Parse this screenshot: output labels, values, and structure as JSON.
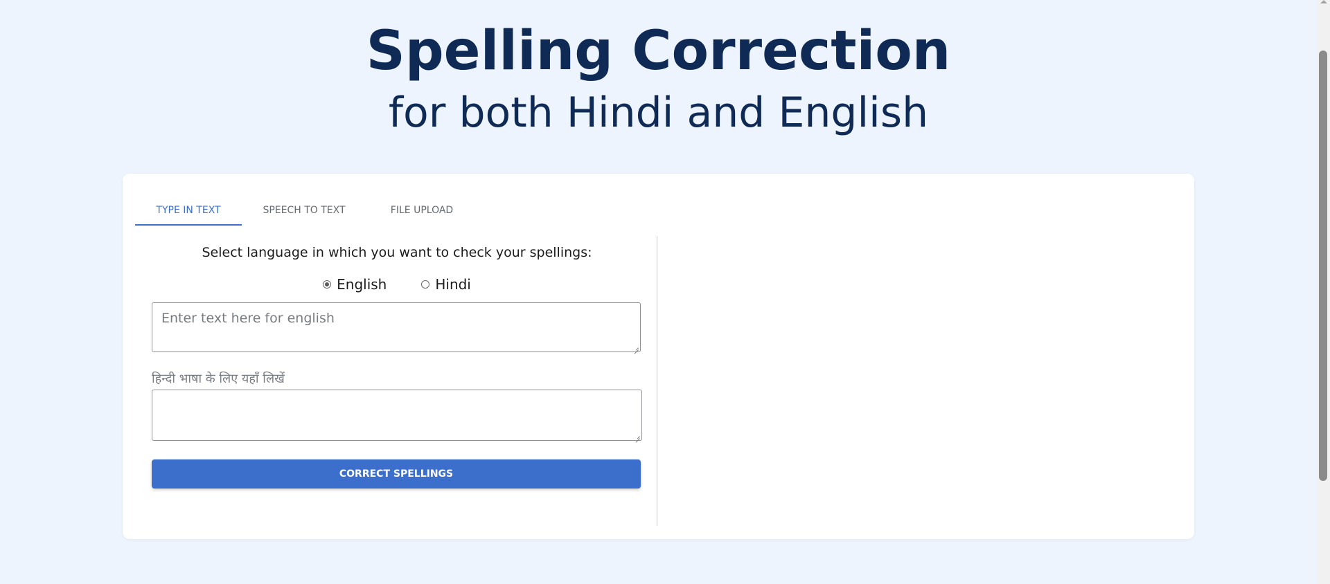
{
  "hero": {
    "title": "Spelling Correction",
    "subtitle": "for both Hindi and English"
  },
  "tabs": [
    {
      "label": "TYPE IN TEXT",
      "active": true
    },
    {
      "label": "SPEECH TO TEXT",
      "active": false
    },
    {
      "label": "FILE UPLOAD",
      "active": false
    }
  ],
  "form": {
    "prompt": "Select language in which you want to check your spellings:",
    "languages": [
      {
        "label": "English",
        "checked": true
      },
      {
        "label": "Hindi",
        "checked": false
      }
    ],
    "english_placeholder": "Enter text here for english",
    "hindi_label": "हिन्दी भाषा के लिए यहाँ लिखें",
    "hindi_value": "",
    "submit_label": "CORRECT SPELLINGS"
  },
  "colors": {
    "background": "#eef4fe",
    "heading": "#0e2a55",
    "accent": "#3c6fcc"
  }
}
